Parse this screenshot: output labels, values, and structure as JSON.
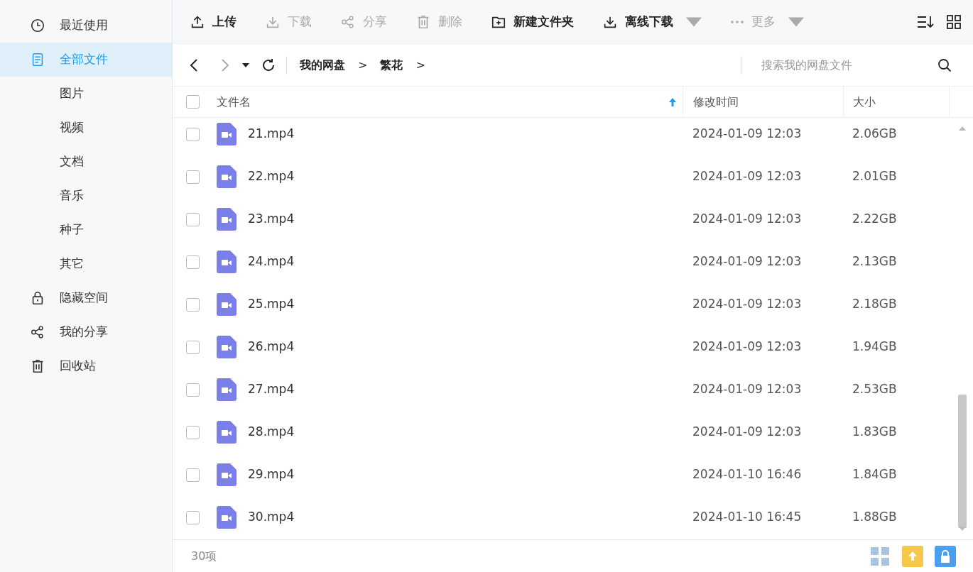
{
  "sidebar": {
    "items": [
      {
        "label": "最近使用",
        "selected": false
      },
      {
        "label": "全部文件",
        "selected": true
      },
      {
        "label": "图片",
        "selected": false
      },
      {
        "label": "视频",
        "selected": false
      },
      {
        "label": "文档",
        "selected": false
      },
      {
        "label": "音乐",
        "selected": false
      },
      {
        "label": "种子",
        "selected": false
      },
      {
        "label": "其它",
        "selected": false
      },
      {
        "label": "隐藏空间",
        "selected": false
      },
      {
        "label": "我的分享",
        "selected": false
      },
      {
        "label": "回收站",
        "selected": false
      }
    ]
  },
  "toolbar": {
    "buttons": [
      {
        "label": "上传",
        "disabled": false,
        "dropdown": false
      },
      {
        "label": "下载",
        "disabled": true,
        "dropdown": false
      },
      {
        "label": "分享",
        "disabled": true,
        "dropdown": false
      },
      {
        "label": "删除",
        "disabled": true,
        "dropdown": false
      },
      {
        "label": "新建文件夹",
        "disabled": false,
        "dropdown": false
      },
      {
        "label": "离线下载",
        "disabled": false,
        "dropdown": true
      },
      {
        "label": "更多",
        "disabled": true,
        "dropdown": true
      }
    ]
  },
  "breadcrumb": [
    {
      "label": "我的网盘",
      "separator": ">"
    },
    {
      "label": "繁花",
      "separator": ">"
    }
  ],
  "search": {
    "placeholder": "搜索我的网盘文件"
  },
  "table": {
    "select_all_checked": false,
    "columns": [
      {
        "label": "文件名",
        "sorted": true
      },
      {
        "label": "修改时间",
        "sorted": false
      },
      {
        "label": "大小",
        "sorted": false
      }
    ],
    "rows": [
      {
        "name": "21.mp4",
        "modified": "2024-01-09 12:03",
        "size": "2.06GB",
        "checked": false
      },
      {
        "name": "22.mp4",
        "modified": "2024-01-09 12:03",
        "size": "2.01GB",
        "checked": false
      },
      {
        "name": "23.mp4",
        "modified": "2024-01-09 12:03",
        "size": "2.22GB",
        "checked": false
      },
      {
        "name": "24.mp4",
        "modified": "2024-01-09 12:03",
        "size": "2.13GB",
        "checked": false
      },
      {
        "name": "25.mp4",
        "modified": "2024-01-09 12:03",
        "size": "2.18GB",
        "checked": false
      },
      {
        "name": "26.mp4",
        "modified": "2024-01-09 12:03",
        "size": "1.94GB",
        "checked": false
      },
      {
        "name": "27.mp4",
        "modified": "2024-01-09 12:03",
        "size": "2.53GB",
        "checked": false
      },
      {
        "name": "28.mp4",
        "modified": "2024-01-09 12:03",
        "size": "1.83GB",
        "checked": false
      },
      {
        "name": "29.mp4",
        "modified": "2024-01-10 16:46",
        "size": "1.84GB",
        "checked": false
      },
      {
        "name": "30.mp4",
        "modified": "2024-01-10 16:45",
        "size": "1.88GB",
        "checked": false
      }
    ]
  },
  "status_bar": {
    "count": "30项"
  }
}
